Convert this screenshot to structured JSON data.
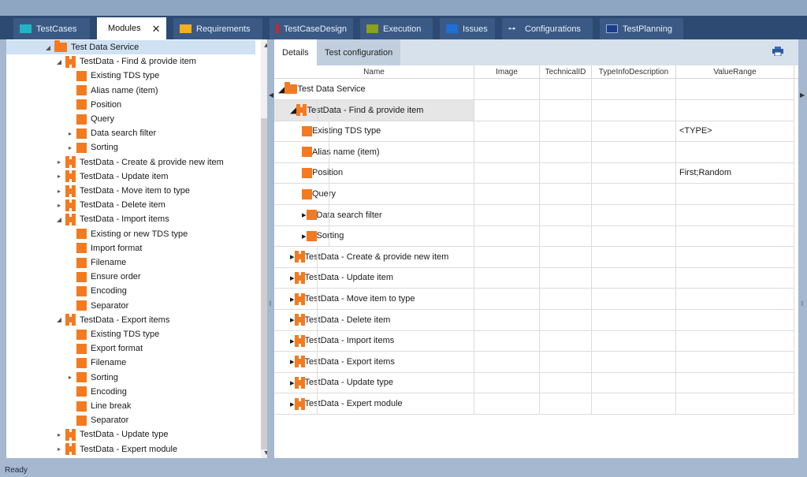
{
  "tabs": [
    {
      "label": "TestCases",
      "color": "#20b4c8"
    },
    {
      "label": "Modules",
      "color": "#f47a1f",
      "active": true
    },
    {
      "label": "Requirements",
      "color": "#f2b01e"
    },
    {
      "label": "TestCaseDesign",
      "color": "#d4202a"
    },
    {
      "label": "Execution",
      "color": "#8aa01e"
    },
    {
      "label": "Issues",
      "color": "#1f6fd4"
    },
    {
      "label": "Configurations",
      "color": "#ffffff"
    },
    {
      "label": "TestPlanning",
      "color": "#1a3d8c"
    }
  ],
  "tree": {
    "items": [
      {
        "label": "Test Data Service",
        "type": "folder",
        "level": 0,
        "expander": "open",
        "selected": true
      },
      {
        "label": "TestData - Find & provide item",
        "type": "module",
        "level": 1,
        "expander": "open"
      },
      {
        "label": "Existing TDS type",
        "type": "attr",
        "level": 2,
        "expander": ""
      },
      {
        "label": "Alias name (item)",
        "type": "attr",
        "level": 2,
        "expander": ""
      },
      {
        "label": "Position",
        "type": "attr",
        "level": 2,
        "expander": ""
      },
      {
        "label": "Query",
        "type": "attr",
        "level": 2,
        "expander": ""
      },
      {
        "label": "Data search filter",
        "type": "attr",
        "level": 2,
        "expander": "closed"
      },
      {
        "label": "Sorting",
        "type": "attr",
        "level": 2,
        "expander": "closed"
      },
      {
        "label": "TestData - Create & provide new item",
        "type": "module",
        "level": 1,
        "expander": "closed"
      },
      {
        "label": "TestData - Update item",
        "type": "module",
        "level": 1,
        "expander": "closed"
      },
      {
        "label": "TestData - Move item to type",
        "type": "module",
        "level": 1,
        "expander": "closed"
      },
      {
        "label": "TestData - Delete item",
        "type": "module",
        "level": 1,
        "expander": "closed"
      },
      {
        "label": "TestData - Import items",
        "type": "module",
        "level": 1,
        "expander": "open"
      },
      {
        "label": "Existing or new TDS type",
        "type": "attr",
        "level": 2,
        "expander": ""
      },
      {
        "label": "Import format",
        "type": "attr",
        "level": 2,
        "expander": ""
      },
      {
        "label": "Filename",
        "type": "attr",
        "level": 2,
        "expander": ""
      },
      {
        "label": "Ensure order",
        "type": "attr",
        "level": 2,
        "expander": ""
      },
      {
        "label": "Encoding",
        "type": "attr",
        "level": 2,
        "expander": ""
      },
      {
        "label": "Separator",
        "type": "attr",
        "level": 2,
        "expander": ""
      },
      {
        "label": "TestData - Export items",
        "type": "module",
        "level": 1,
        "expander": "open"
      },
      {
        "label": "Existing TDS type",
        "type": "attr",
        "level": 2,
        "expander": ""
      },
      {
        "label": "Export format",
        "type": "attr",
        "level": 2,
        "expander": ""
      },
      {
        "label": "Filename",
        "type": "attr",
        "level": 2,
        "expander": ""
      },
      {
        "label": "Sorting",
        "type": "attr",
        "level": 2,
        "expander": "closed"
      },
      {
        "label": "Encoding",
        "type": "attr",
        "level": 2,
        "expander": ""
      },
      {
        "label": "Line break",
        "type": "attr",
        "level": 2,
        "expander": ""
      },
      {
        "label": "Separator",
        "type": "attr",
        "level": 2,
        "expander": ""
      },
      {
        "label": "TestData - Update type",
        "type": "module",
        "level": 1,
        "expander": "closed"
      },
      {
        "label": "TestData - Expert module",
        "type": "module",
        "level": 1,
        "expander": "closed"
      }
    ]
  },
  "details": {
    "subtabs": [
      "Details",
      "Test configuration"
    ],
    "columns": [
      "Name",
      "Image",
      "TechnicalID",
      "TypeInfoDescription",
      "ValueRange"
    ],
    "rows": [
      {
        "name": "Test Data Service",
        "type": "folder",
        "level": 0,
        "expander": "open",
        "valueRange": ""
      },
      {
        "name": "TestData - Find & provide item",
        "type": "module",
        "level": 1,
        "expander": "open",
        "valueRange": "",
        "selected": true
      },
      {
        "name": "Existing TDS type",
        "type": "attr",
        "level": 2,
        "expander": "",
        "valueRange": "<TYPE>"
      },
      {
        "name": "Alias name (item)",
        "type": "attr",
        "level": 2,
        "expander": "",
        "valueRange": ""
      },
      {
        "name": "Position",
        "type": "attr",
        "level": 2,
        "expander": "",
        "valueRange": "First;Random"
      },
      {
        "name": "Query",
        "type": "attr",
        "level": 2,
        "expander": "",
        "valueRange": ""
      },
      {
        "name": "Data search filter",
        "type": "attr",
        "level": 2,
        "expander": "closed",
        "valueRange": ""
      },
      {
        "name": "Sorting",
        "type": "attr",
        "level": 2,
        "expander": "closed",
        "valueRange": ""
      },
      {
        "name": "TestData - Create & provide new item",
        "type": "module",
        "level": 1,
        "expander": "closed",
        "valueRange": ""
      },
      {
        "name": "TestData - Update item",
        "type": "module",
        "level": 1,
        "expander": "closed",
        "valueRange": ""
      },
      {
        "name": "TestData - Move item to type",
        "type": "module",
        "level": 1,
        "expander": "closed",
        "valueRange": ""
      },
      {
        "name": "TestData - Delete item",
        "type": "module",
        "level": 1,
        "expander": "closed",
        "valueRange": ""
      },
      {
        "name": "TestData - Import items",
        "type": "module",
        "level": 1,
        "expander": "closed",
        "valueRange": ""
      },
      {
        "name": "TestData - Export items",
        "type": "module",
        "level": 1,
        "expander": "closed",
        "valueRange": ""
      },
      {
        "name": "TestData - Update type",
        "type": "module",
        "level": 1,
        "expander": "closed",
        "valueRange": ""
      },
      {
        "name": "TestData - Expert module",
        "type": "module",
        "level": 1,
        "expander": "closed",
        "valueRange": ""
      }
    ]
  },
  "status": {
    "text": "Ready"
  }
}
